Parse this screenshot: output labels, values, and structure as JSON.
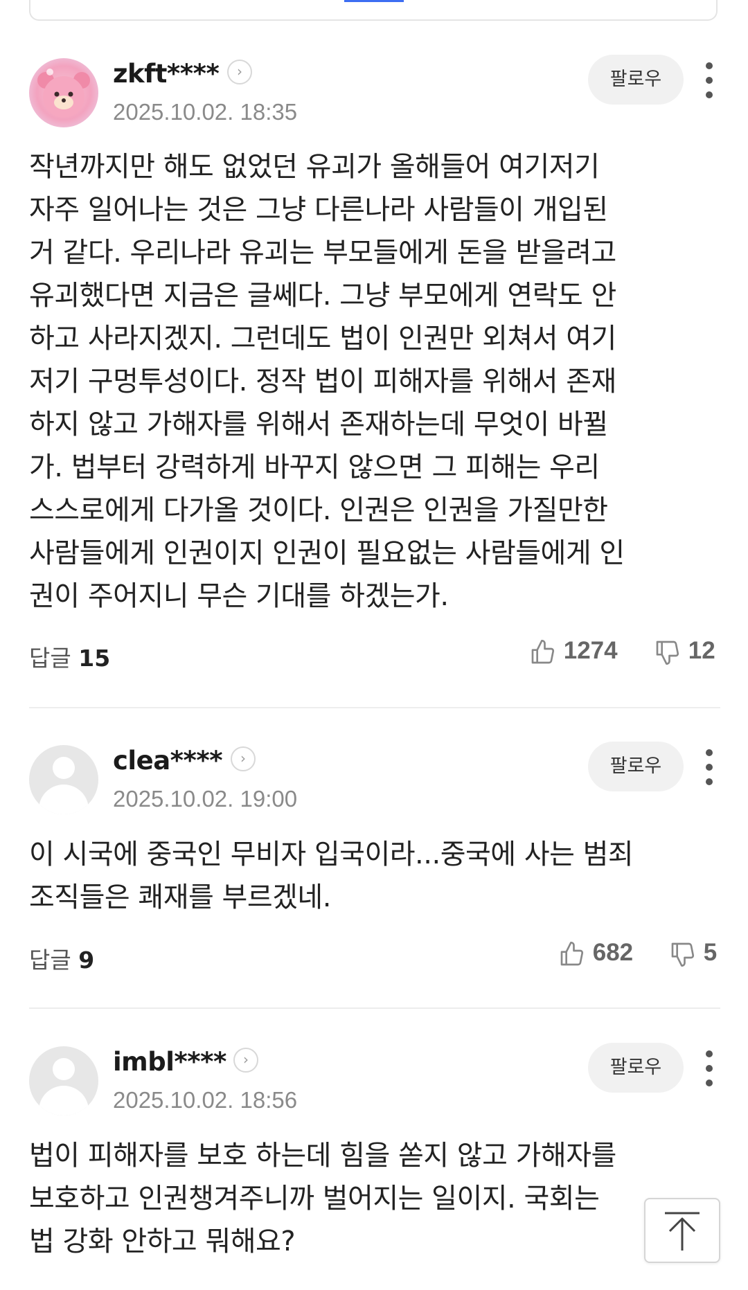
{
  "comments": [
    {
      "username": "zkft****",
      "timestamp": "2025.10.02. 18:35",
      "follow_label": "팔로우",
      "text": "작년까지만 해도 없었던 유괴가 올해들어 여기저기\n자주 일어나는 것은 그냥 다른나라 사람들이 개입된\n거 같다. 우리나라 유괴는 부모들에게 돈을 받을려고\n유괴했다면 지금은 글쎄다. 그냥 부모에게 연락도 안\n하고 사라지겠지. 그런데도 법이 인권만 외쳐서 여기\n저기 구멍투성이다. 정작 법이 피해자를 위해서 존재\n하지 않고 가해자를 위해서 존재하는데 무엇이 바뀔\n가. 법부터 강력하게 바꾸지 않으면 그 피해는 우리\n스스로에게 다가올 것이다. 인권은 인권을 가질만한\n사람들에게 인권이지 인권이 필요없는 사람들에게 인\n권이 주어지니 무슨 기대를 하겠는가.",
      "reply_label": "답글",
      "reply_count": "15",
      "likes": "1274",
      "dislikes": "12"
    },
    {
      "username": "clea****",
      "timestamp": "2025.10.02. 19:00",
      "follow_label": "팔로우",
      "text": "이 시국에 중국인 무비자 입국이라...중국에 사는 범죄\n조직들은 쾌재를 부르겠네.",
      "reply_label": "답글",
      "reply_count": "9",
      "likes": "682",
      "dislikes": "5"
    },
    {
      "username": "imbl****",
      "timestamp": "2025.10.02. 18:56",
      "follow_label": "팔로우",
      "text": "법이 피해자를 보호 하는데 힘을 쏟지 않고 가해자를\n보호하고 인권챙겨주니까 벌어지는 일이지. 국회는\n법 강화 안하고 뭐해요?"
    }
  ],
  "icons": {
    "profile_arrow": "chevron-right-circle-icon",
    "more": "more-vertical-icon",
    "like": "thumbs-up-icon",
    "dislike": "thumbs-down-icon",
    "scroll_top": "arrow-up-icon"
  },
  "colors": {
    "accent": "#3d6ef2",
    "follow_bg": "#f1f1f1",
    "timestamp": "#8a8a8a"
  }
}
